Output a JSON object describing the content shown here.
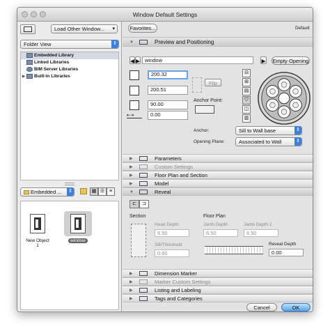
{
  "window": {
    "title": "Window Default Settings"
  },
  "left": {
    "load_button": "Load Other Window...",
    "folder_view": "Folder View",
    "tree": [
      {
        "label": "Embedded Library",
        "selected": true,
        "expand": ""
      },
      {
        "label": "Linked Libraries",
        "selected": false,
        "expand": ""
      },
      {
        "label": "BIM Server Libraries",
        "selected": false,
        "expand": ""
      },
      {
        "label": "Built-in Libraries",
        "selected": false,
        "expand": "▶"
      }
    ],
    "bottom_select": "Embedded ...",
    "objects": [
      {
        "label": "New Object 1",
        "selected": false
      },
      {
        "label": "window",
        "selected": true
      }
    ]
  },
  "right": {
    "favorites": "Favorites...",
    "default_label": "Default",
    "sections": {
      "preview": "Preview and Positioning",
      "parameters": "Parameters",
      "custom_settings": "Custom Settings",
      "floor_plan": "Floor Plan and Section",
      "model": "Model",
      "reveal": "Reveal",
      "dimension_marker": "Dimension Marker",
      "marker_custom": "Marker Custom Settings",
      "listing": "Listing and Labeling",
      "tags": "Tags and Categories"
    },
    "object_name": "window",
    "empty_opening": "Empty Opening",
    "width": "200.32",
    "height": "200.51",
    "sill": "90.00",
    "offset": "0.00",
    "flip": "Flip",
    "anchor_point_label": "Anchor Point:",
    "anchor_label": "Anchor:",
    "anchor_value": "Sill to Wall base",
    "opening_plane_label": "Opening Plane:",
    "opening_plane_value": "Associated to Wall",
    "reveal": {
      "section_label": "Section",
      "floor_plan_label": "Floor Plan",
      "head_depth_label": "Head Depth",
      "head_depth": "6.50",
      "sill_threshold_label": "Sill/Threshold",
      "sill_threshold": "0.00",
      "jamb_depth_label": "Jamb Depth",
      "jamb_depth": "6.50",
      "jamb_depth2_label": "Jamb Depth 2",
      "jamb_depth2": "6.50",
      "reveal_depth_label": "Reveal Depth",
      "reveal_depth": "0.00"
    },
    "cancel": "Cancel",
    "ok": "OK"
  },
  "colors": {
    "accent": "#3f7fd6",
    "ok_button": "#5aa6ee"
  }
}
